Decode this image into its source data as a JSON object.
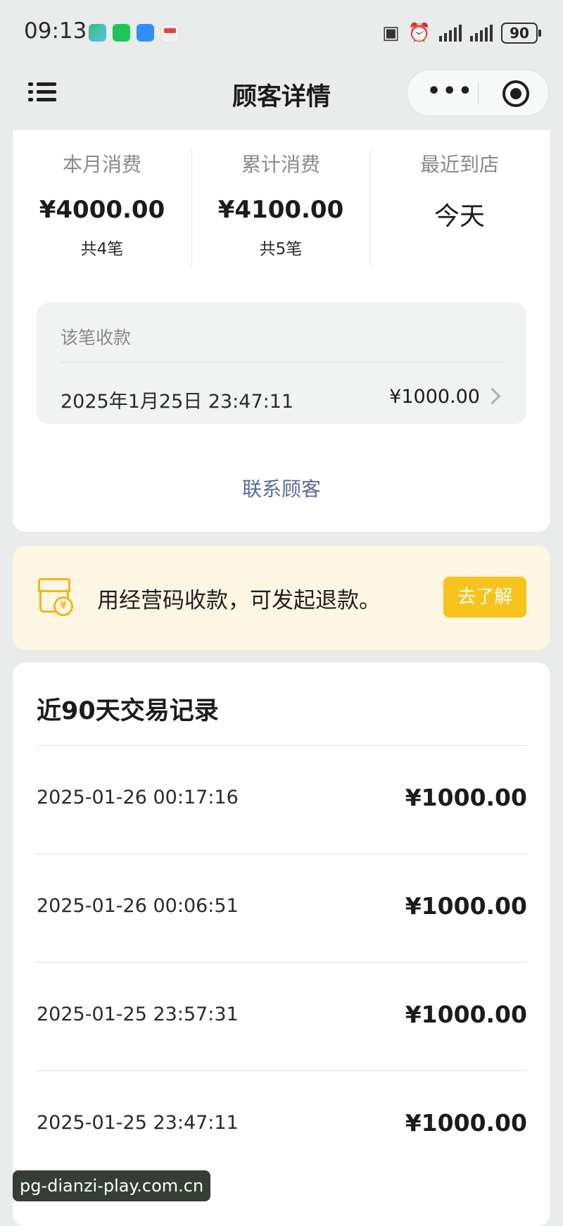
{
  "status_bar": {
    "time": "09:13",
    "battery": "90",
    "icons": [
      "app-notification-icon",
      "wechat-icon",
      "message-icon",
      "calendar-icon",
      "nfc-icon",
      "alarm-icon",
      "signal-icon",
      "battery-icon"
    ]
  },
  "nav": {
    "title": "顾客详情",
    "more_label": "•••"
  },
  "stats": [
    {
      "label": "本月消费",
      "value": "¥4000.00",
      "sub": "共4笔"
    },
    {
      "label": "累计消费",
      "value": "¥4100.00",
      "sub": "共5笔"
    },
    {
      "label": "最近到店",
      "value": "今天",
      "sub": ""
    }
  ],
  "receipt": {
    "title": "该笔收款",
    "datetime": "2025年1月25日 23:47:11",
    "amount": "¥1000.00"
  },
  "contact_label": "联系顾客",
  "promo": {
    "text": "用经营码收款，可发起退款。",
    "button": "去了解",
    "coin_symbol": "¥",
    "accent": "#F7C31D"
  },
  "transactions": {
    "title": "近90天交易记录",
    "rows": [
      {
        "datetime": "2025-01-26 00:17:16",
        "amount": "¥1000.00"
      },
      {
        "datetime": "2025-01-26 00:06:51",
        "amount": "¥1000.00"
      },
      {
        "datetime": "2025-01-25 23:57:31",
        "amount": "¥1000.00"
      },
      {
        "datetime": "2025-01-25 23:47:11",
        "amount": "¥1000.00"
      }
    ]
  },
  "watermark": "pg-dianzi-play.com.cn",
  "colors": {
    "link": "#576B95",
    "background": "#E9ECEB",
    "promo_bg": "#FDF6E3"
  }
}
